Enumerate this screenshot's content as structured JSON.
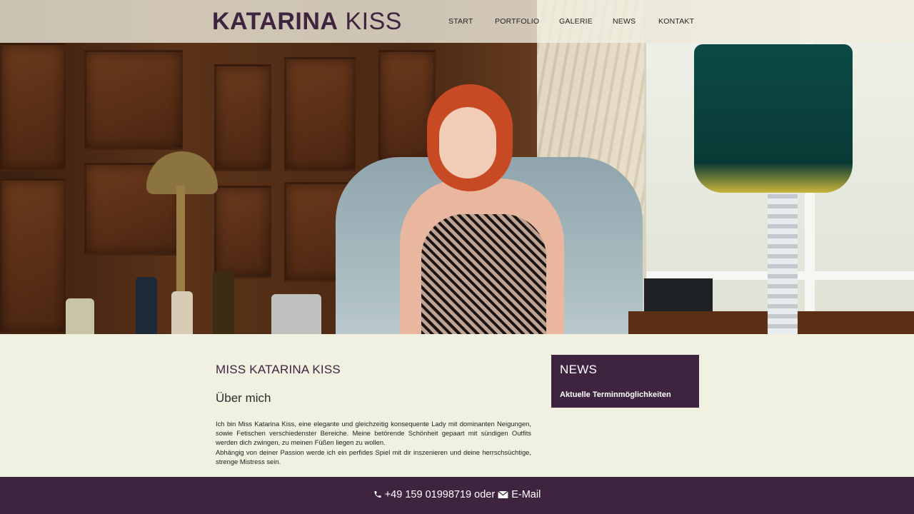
{
  "brand": {
    "first": "KATARINA",
    "last": "KISS"
  },
  "nav": [
    {
      "label": "START"
    },
    {
      "label": "PORTFOLIO"
    },
    {
      "label": "GALERIE"
    },
    {
      "label": "NEWS"
    },
    {
      "label": "KONTAKT"
    }
  ],
  "main": {
    "title": "MISS KATARINA KISS",
    "subtitle": "Über mich",
    "paragraph1": "Ich bin Miss Katarina Kiss, eine elegante und gleichzeitig konsequente Lady mit dominanten Neigungen, sowie Fetischen verschiedenster Bereiche. Meine betörende Schönheit gepaart mit sündigen Outfits werden dich zwingen, zu meinen Füßen liegen zu wollen.",
    "paragraph2": "Abhängig von deiner Passion werde ich ein perfides Spiel mit dir inszenieren und deine herrschsüchtige, strenge Mistress sein."
  },
  "sidebar": {
    "news_title": "NEWS",
    "news_link": "Aktuelle Terminmöglichkeiten"
  },
  "footer": {
    "phone": "+49 159 01998719",
    "separator": "oder",
    "email_label": "E-Mail"
  },
  "icons": {
    "phone": "phone-icon",
    "email": "envelope-icon"
  },
  "colors": {
    "brand": "#3f2440",
    "background": "#f1f1e1"
  }
}
